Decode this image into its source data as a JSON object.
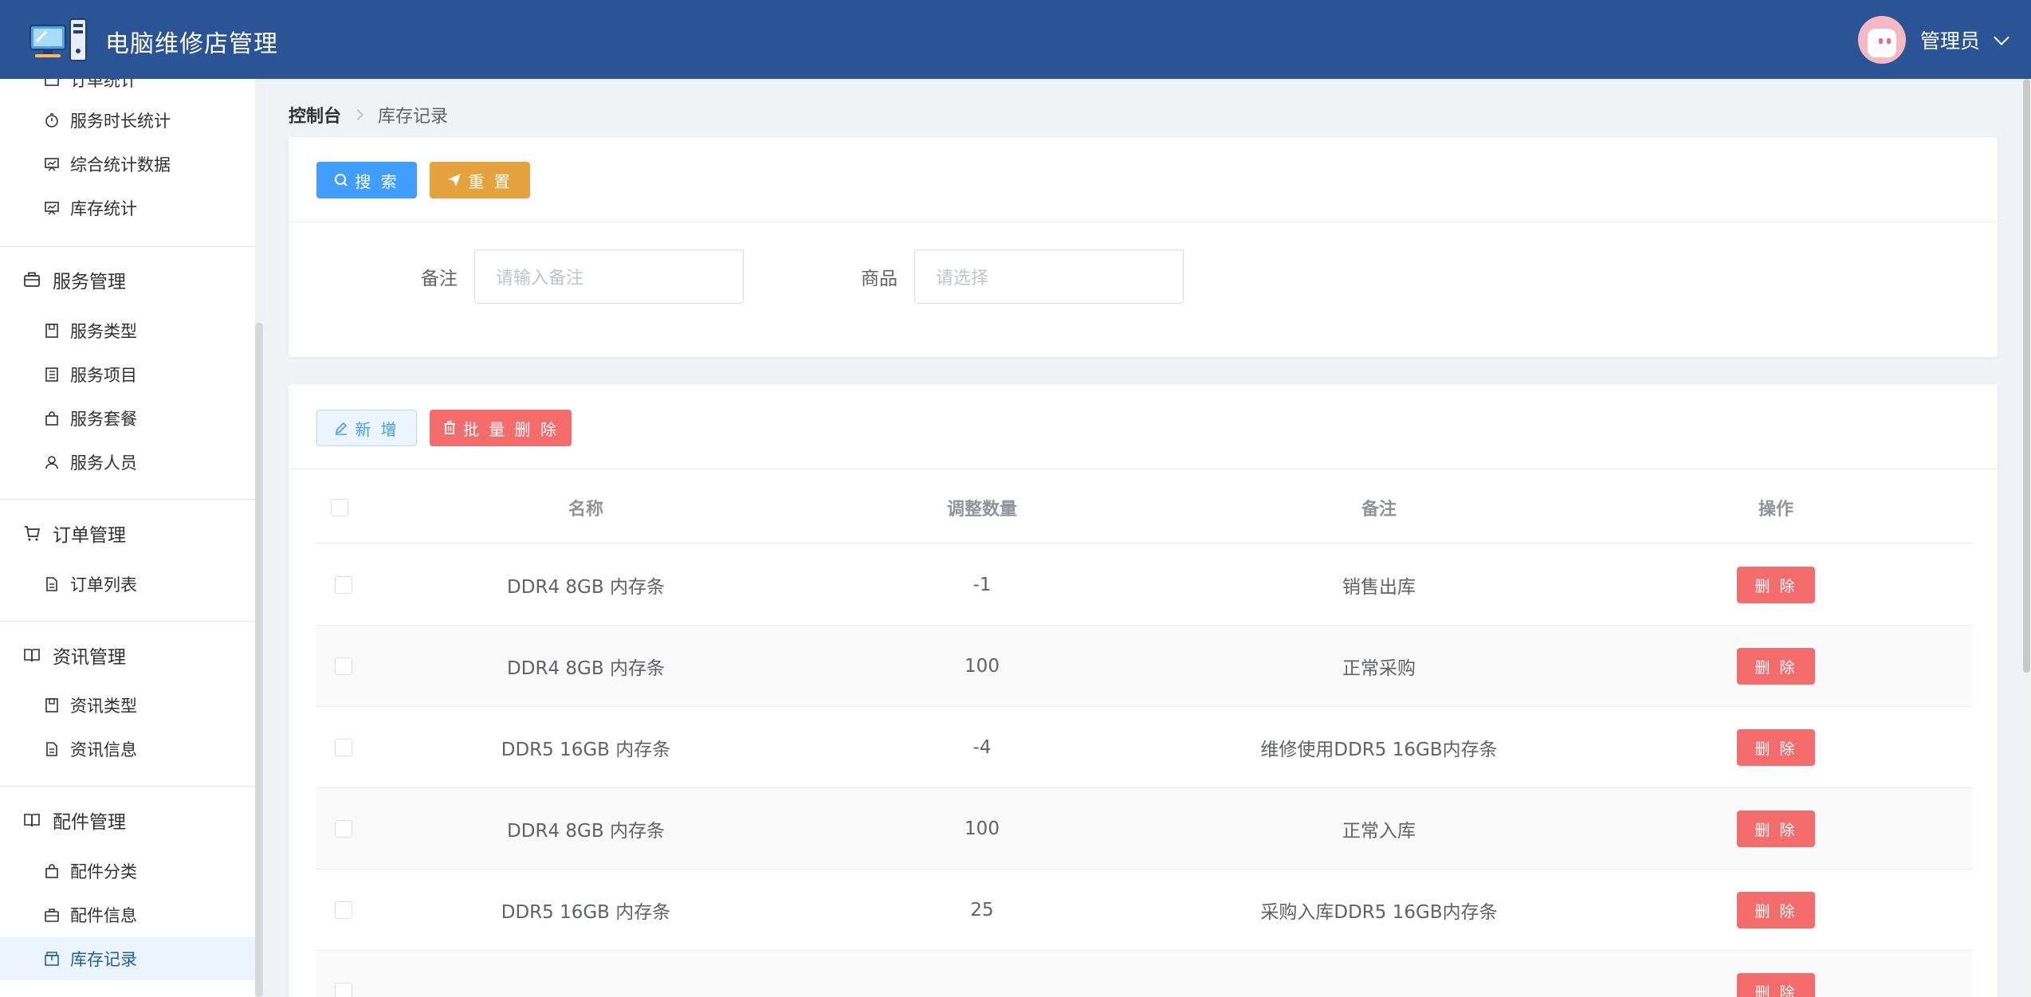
{
  "header": {
    "app_title": "电脑维修店管理",
    "user_name": "管理员",
    "accent_color": "#2b5497"
  },
  "sidebar": {
    "items": [
      {
        "type": "sub",
        "label": "订单统计",
        "icon": "chart-icon"
      },
      {
        "type": "sub",
        "label": "服务时长统计",
        "icon": "timer-icon"
      },
      {
        "type": "sub",
        "label": "综合统计数据",
        "icon": "presentation-icon"
      },
      {
        "type": "sub",
        "label": "库存统计",
        "icon": "presentation-icon"
      },
      {
        "type": "group",
        "label": "服务管理",
        "icon": "briefcase-icon"
      },
      {
        "type": "sub",
        "label": "服务类型",
        "icon": "notebook-icon"
      },
      {
        "type": "sub",
        "label": "服务项目",
        "icon": "tickets-icon"
      },
      {
        "type": "sub",
        "label": "服务套餐",
        "icon": "bag-icon"
      },
      {
        "type": "sub",
        "label": "服务人员",
        "icon": "user-icon"
      },
      {
        "type": "group",
        "label": "订单管理",
        "icon": "cart-icon"
      },
      {
        "type": "sub",
        "label": "订单列表",
        "icon": "document-icon"
      },
      {
        "type": "group",
        "label": "资讯管理",
        "icon": "book-icon"
      },
      {
        "type": "sub",
        "label": "资讯类型",
        "icon": "notebook-icon"
      },
      {
        "type": "sub",
        "label": "资讯信息",
        "icon": "document-icon"
      },
      {
        "type": "group",
        "label": "配件管理",
        "icon": "book-icon"
      },
      {
        "type": "sub",
        "label": "配件分类",
        "icon": "bag-icon"
      },
      {
        "type": "sub",
        "label": "配件信息",
        "icon": "briefcase-icon"
      },
      {
        "type": "sub",
        "label": "库存记录",
        "icon": "box-icon",
        "active": true
      }
    ]
  },
  "breadcrumb": {
    "root": "控制台",
    "current": "库存记录"
  },
  "search": {
    "search_label": "搜 索",
    "reset_label": "重 置",
    "remark_label": "备注",
    "remark_placeholder": "请输入备注",
    "product_label": "商品",
    "product_placeholder": "请选择"
  },
  "toolbar": {
    "add_label": "新 增",
    "batch_delete_label": "批 量 删 除"
  },
  "table": {
    "columns": [
      "名称",
      "调整数量",
      "备注",
      "操作"
    ],
    "delete_label": "删 除",
    "rows": [
      {
        "name": "DDR4 8GB 内存条",
        "qty": "-1",
        "remark": "销售出库"
      },
      {
        "name": "DDR4 8GB 内存条",
        "qty": "100",
        "remark": "正常采购"
      },
      {
        "name": "DDR5 16GB 内存条",
        "qty": "-4",
        "remark": "维修使用DDR5 16GB内存条"
      },
      {
        "name": "DDR4 8GB 内存条",
        "qty": "100",
        "remark": "正常入库"
      },
      {
        "name": "DDR5 16GB 内存条",
        "qty": "25",
        "remark": "采购入库DDR5 16GB内存条"
      }
    ]
  }
}
